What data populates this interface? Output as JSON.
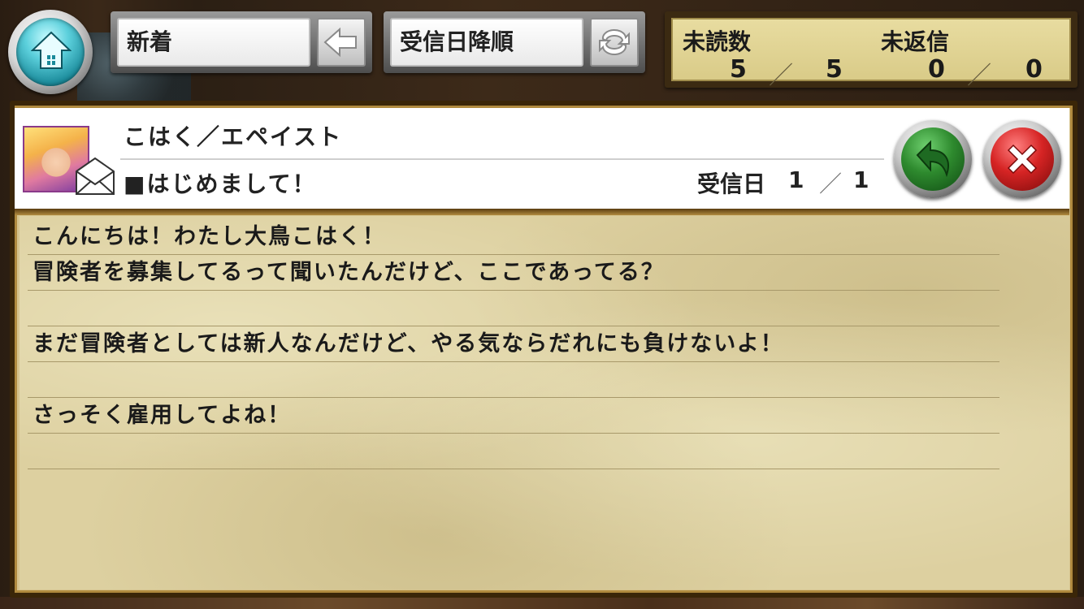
{
  "filter": {
    "label": "新着"
  },
  "sort": {
    "label": "受信日降順"
  },
  "counts": {
    "unread_label": "未読数",
    "unread": "5",
    "unread_total": "5",
    "unreplied_label": "未返信",
    "unreplied": "0",
    "unreplied_total": "0",
    "separator": "／"
  },
  "message": {
    "sender": "こはく／エペイスト",
    "subject": "■はじめまして！",
    "received_label": "受信日",
    "received_index": "1",
    "received_total": "1",
    "separator": "／",
    "body": [
      "こんにちは！わたし大鳥こはく！",
      "冒険者を募集してるって聞いたんだけど、ここであってる？",
      "",
      "まだ冒険者としては新人なんだけど、やる気ならだれにも負けないよ！",
      "",
      "さっそく雇用してよね！",
      ""
    ]
  },
  "icons": {
    "home": "home-icon",
    "back": "back-arrow-icon",
    "refresh": "refresh-icon",
    "reply": "reply-icon",
    "close": "close-icon",
    "envelope": "envelope-icon"
  },
  "colors": {
    "home_accent": "#5cd0dc",
    "reply_accent": "#2e8a2e",
    "close_accent": "#d62424",
    "paper": "#ddd0a0",
    "count_panel": "#e8dca0"
  }
}
